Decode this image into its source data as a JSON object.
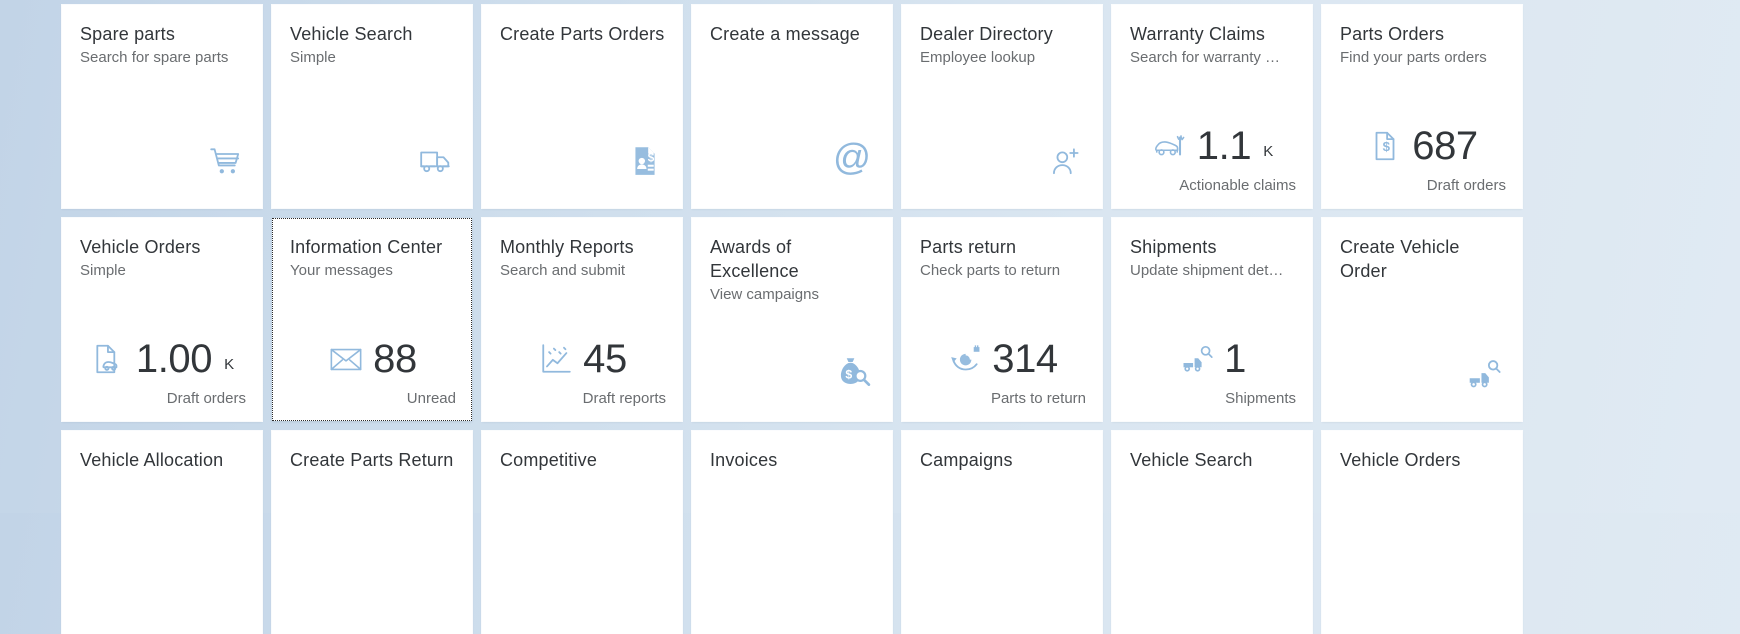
{
  "theme": {
    "tile_background": "#ffffff",
    "page_background": "#cdddec",
    "title_color": "#32363a",
    "subtitle_color": "#6a6d70",
    "icon_color": "#91b9dd",
    "kpi_color": "#32363a"
  },
  "tiles": [
    {
      "title": "Spare parts",
      "subtitle": "Search for spare parts",
      "icon": "shopping-cart-icon",
      "value": "",
      "unit": "",
      "footer": ""
    },
    {
      "title": "Vehicle Search",
      "subtitle": "Simple",
      "icon": "truck-icon",
      "value": "",
      "unit": "",
      "footer": ""
    },
    {
      "title": "Create Parts Orders",
      "subtitle": "",
      "icon": "document-person-dollar-icon",
      "value": "",
      "unit": "",
      "footer": ""
    },
    {
      "title": "Create a message",
      "subtitle": "",
      "icon": "at-sign-icon",
      "value": "",
      "unit": "",
      "footer": ""
    },
    {
      "title": "Dealer Directory",
      "subtitle": "Employee lookup",
      "icon": "add-person-icon",
      "value": "",
      "unit": "",
      "footer": ""
    },
    {
      "title": "Warranty Claims",
      "subtitle": "Search for warranty …",
      "icon": "car-repair-icon",
      "value": "1.1",
      "unit": "K",
      "footer": "Actionable claims"
    },
    {
      "title": "Parts Orders",
      "subtitle": "Find your parts orders",
      "icon": "document-dollar-icon",
      "value": "687",
      "unit": "",
      "footer": "Draft orders"
    },
    {
      "title": "Vehicle Orders",
      "subtitle": "Simple",
      "icon": "document-car-icon",
      "value": "1.00",
      "unit": "K",
      "footer": "Draft orders"
    },
    {
      "title": "Information Center",
      "subtitle": "Your messages",
      "icon": "envelope-icon",
      "value": "88",
      "unit": "",
      "footer": "Unread",
      "focused": true
    },
    {
      "title": "Monthly Reports",
      "subtitle": "Search and submit",
      "icon": "line-chart-icon",
      "value": "45",
      "unit": "",
      "footer": "Draft reports"
    },
    {
      "title": "Awards of Excellence",
      "subtitle": "View campaigns",
      "icon": "money-bag-search-icon",
      "value": "",
      "unit": "",
      "footer": ""
    },
    {
      "title": "Parts return",
      "subtitle": "Check parts to return",
      "icon": "parts-return-icon",
      "value": "314",
      "unit": "",
      "footer": "Parts to return"
    },
    {
      "title": "Shipments",
      "subtitle": "Update shipment det…",
      "icon": "truck-search-icon",
      "value": "1",
      "unit": "",
      "footer": "Shipments"
    },
    {
      "title": "Create Vehicle Order",
      "subtitle": "",
      "icon": "truck-search-icon",
      "value": "",
      "unit": "",
      "footer": ""
    },
    {
      "title": "Vehicle Allocation",
      "subtitle": "",
      "icon": "",
      "value": "",
      "unit": "",
      "footer": ""
    },
    {
      "title": "Create Parts Return",
      "subtitle": "",
      "icon": "",
      "value": "",
      "unit": "",
      "footer": ""
    },
    {
      "title": "Competitive",
      "subtitle": "",
      "icon": "",
      "value": "",
      "unit": "",
      "footer": ""
    },
    {
      "title": "Invoices",
      "subtitle": "",
      "icon": "",
      "value": "",
      "unit": "",
      "footer": ""
    },
    {
      "title": "Campaigns",
      "subtitle": "",
      "icon": "",
      "value": "",
      "unit": "",
      "footer": ""
    },
    {
      "title": "Vehicle Search",
      "subtitle": "",
      "icon": "",
      "value": "",
      "unit": "",
      "footer": ""
    },
    {
      "title": "Vehicle Orders",
      "subtitle": "",
      "icon": "",
      "value": "",
      "unit": "",
      "footer": ""
    }
  ]
}
